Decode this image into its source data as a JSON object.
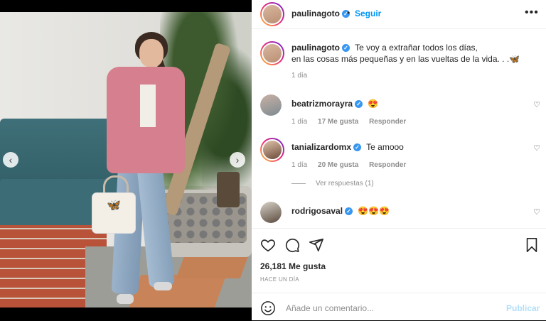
{
  "post": {
    "username": "paulinagoto",
    "follow_label": "Seguir",
    "more_label": "•••",
    "separator": "•",
    "caption_line1": "Te voy a extrañar todos los días,",
    "caption_line2": "en las cosas más pequeñas y en las vueltas de la vida. . .🦋",
    "caption_time": "1 día",
    "likes": "26,181 Me gusta",
    "posted_ago": "Hace un día"
  },
  "comments": [
    {
      "username": "beatrizmorayra",
      "text": "😍",
      "time": "1 día",
      "likes": "17 Me gusta",
      "reply": "Responder"
    },
    {
      "username": "tanializardomx",
      "text": "Te amooo",
      "time": "1 día",
      "likes": "20 Me gusta",
      "reply": "Responder"
    },
    {
      "username": "rodrigosaval",
      "text": "😍😍😍"
    }
  ],
  "view_replies": "Ver respuestas (1)",
  "add_comment": {
    "placeholder": "Añade un comentario...",
    "publish_label": "Publicar"
  },
  "carousel": {
    "prev": "‹",
    "next": "›"
  },
  "colors": {
    "accent": "#0095f6",
    "publish_disabled": "#b2dffc",
    "verified": "#3897f0"
  }
}
